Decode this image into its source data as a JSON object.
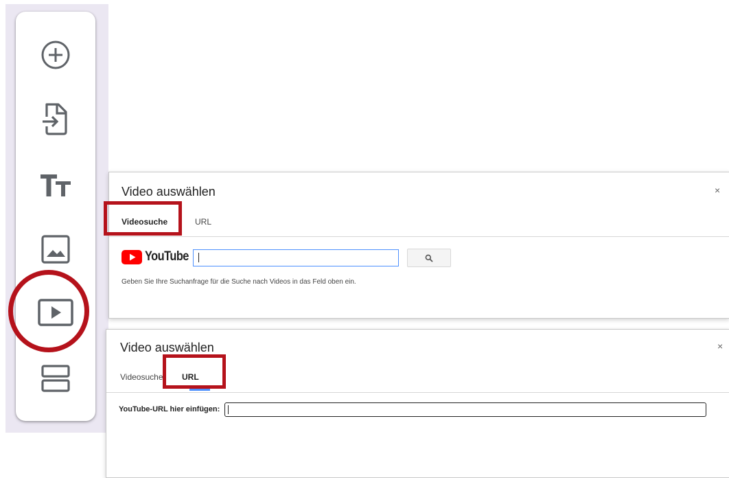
{
  "toolbar": {
    "items": [
      {
        "name": "add-question",
        "icon": "add-circle-icon"
      },
      {
        "name": "import-questions",
        "icon": "import-file-icon"
      },
      {
        "name": "add-title",
        "icon": "title-text-icon"
      },
      {
        "name": "add-image",
        "icon": "image-icon"
      },
      {
        "name": "add-video",
        "icon": "video-icon"
      },
      {
        "name": "add-section",
        "icon": "section-icon"
      }
    ]
  },
  "dialog_search": {
    "title": "Video auswählen",
    "close": "×",
    "tabs": [
      {
        "label": "Videosuche",
        "active": true
      },
      {
        "label": "URL",
        "active": false
      }
    ],
    "logo_text": "YouTube",
    "search_value": "",
    "hint": "Geben Sie Ihre Suchanfrage für die Suche nach Videos in das Feld oben ein."
  },
  "dialog_url": {
    "title": "Video auswählen",
    "close": "×",
    "tabs": [
      {
        "label": "Videosuche",
        "active": false
      },
      {
        "label": "URL",
        "active": true
      }
    ],
    "url_label": "YouTube-URL hier einfügen:",
    "url_value": ""
  },
  "colors": {
    "annotation_red": "#b5121b",
    "tab_underline": "#4d90fe",
    "youtube_red": "#ff0000",
    "toolbar_backdrop": "#ebe7f2"
  }
}
